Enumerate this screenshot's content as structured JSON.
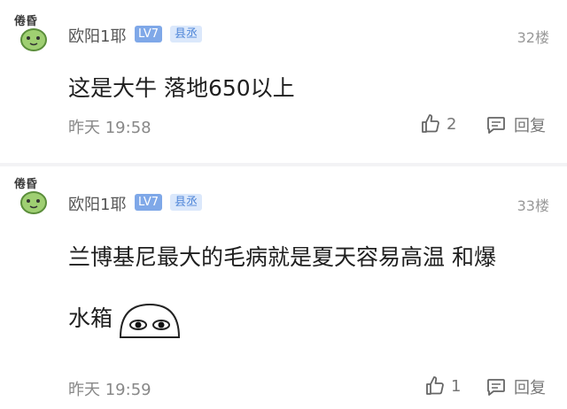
{
  "posts": [
    {
      "username": "欧阳1耶",
      "level": "LV7",
      "title": "县丞",
      "floor": "32楼",
      "content": "这是大牛 落地650以上",
      "time": "昨天 19:58",
      "likes": "2",
      "reply_label": "回复",
      "avatar_text": "倦昏"
    },
    {
      "username": "欧阳1耶",
      "level": "LV7",
      "title": "县丞",
      "floor": "33楼",
      "content_line1": "兰博基尼最大的毛病就是夏天容易高温 和爆",
      "content_line2": "水箱",
      "time": "昨天 19:59",
      "likes": "1",
      "reply_label": "回复",
      "avatar_text": "倦昏"
    }
  ],
  "colors": {
    "level_badge": "#7fa8e8",
    "title_badge_bg": "#dbe8fb",
    "title_badge_text": "#4f86d8",
    "meta_text": "#888888"
  },
  "icons": {
    "like": "thumbs-up-icon",
    "reply": "comment-icon",
    "emoji": "sticker-face"
  }
}
